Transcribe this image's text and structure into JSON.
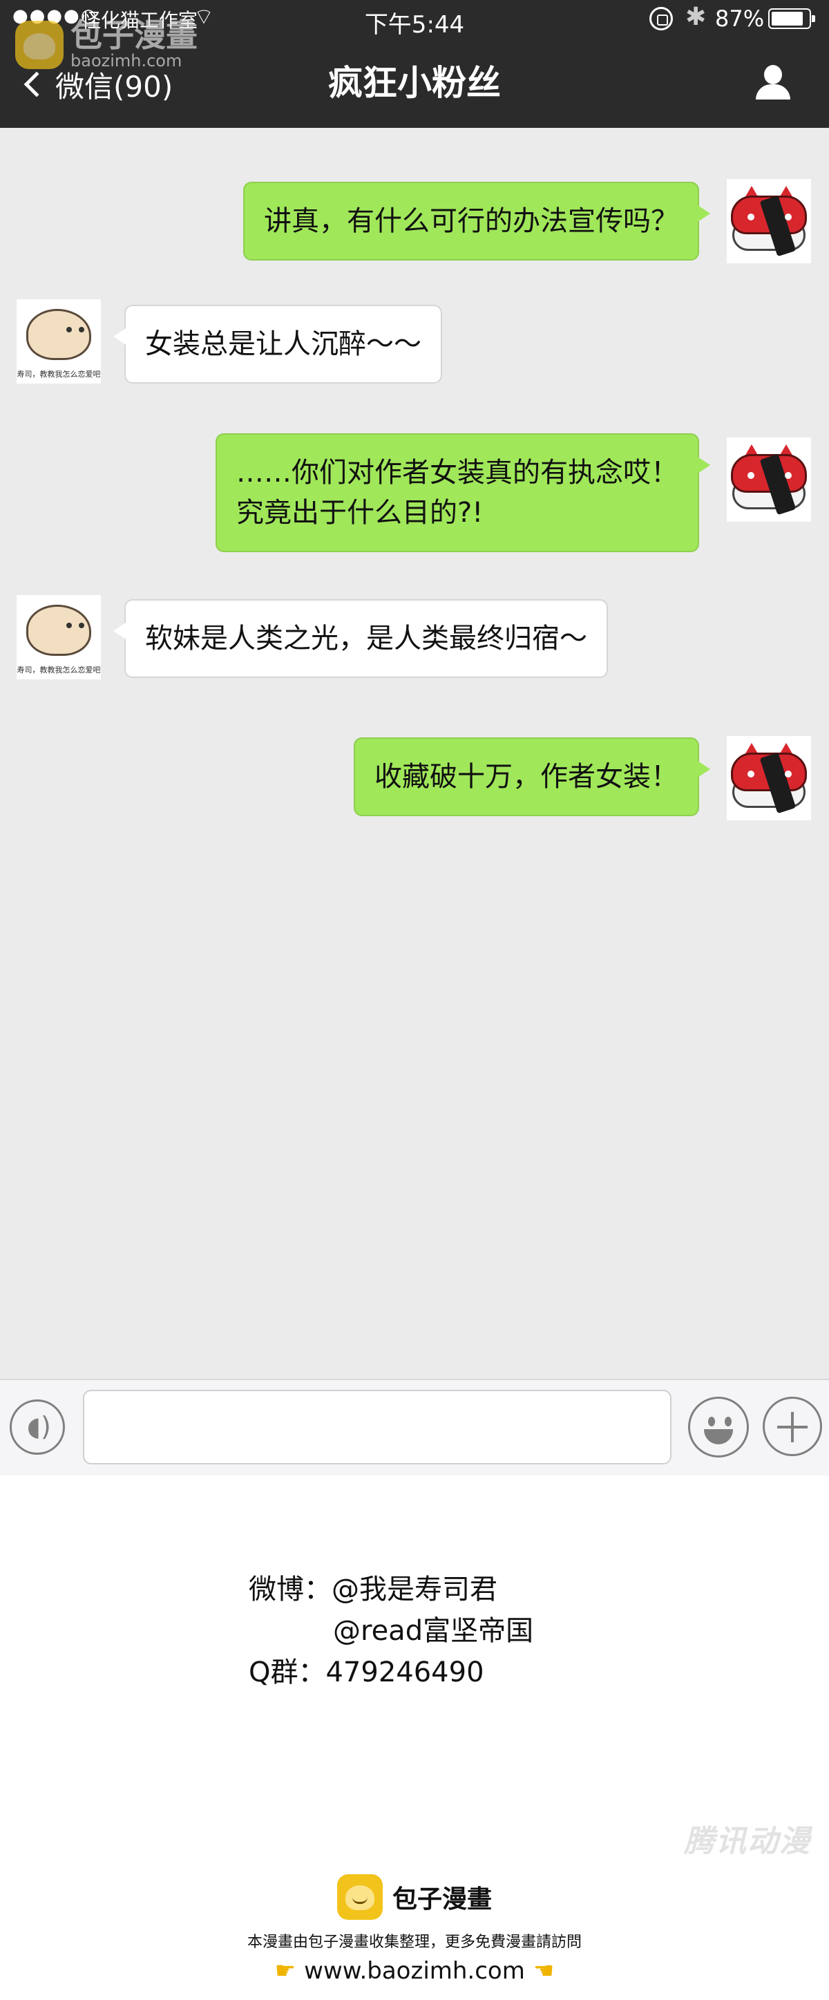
{
  "status_bar": {
    "signal": "●●●●○",
    "carrier": "怪化猫工作室",
    "time": "下午5:44",
    "battery_percent": "87%",
    "battery_level": 0.87
  },
  "nav": {
    "back_label": "微信(90)",
    "title": "疯狂小粉丝"
  },
  "watermark": {
    "brand": "包子漫畫",
    "url": "baozimh.com"
  },
  "messages": [
    {
      "from": "me",
      "text": "讲真，有什么可行的办法宣传吗？"
    },
    {
      "from": "them",
      "text": "女装总是让人沉醉～～"
    },
    {
      "from": "me",
      "lines": [
        "……你们对作者女装真的有执念哎！",
        "究竟出于什么目的?!"
      ]
    },
    {
      "from": "them",
      "text": "软妹是人类之光，是人类最终归宿～"
    },
    {
      "from": "me",
      "text": "收藏破十万，作者女装！"
    }
  ],
  "avatar_caption": "寿司，教教我怎么恋爱吧",
  "input_bar": {
    "text_value": ""
  },
  "credits": {
    "weibo_label": "微博：",
    "weibo_1": "@我是寿司君",
    "weibo_2": "@read富坚帝国",
    "qq_label": "Q群：",
    "qq_number": "479246490"
  },
  "tencent_watermark": "腾讯动漫",
  "footer": {
    "brand": "包子漫畫",
    "note": "本漫畫由包子漫畫收集整理，更多免費漫畫請訪問",
    "url": "www.baozimh.com"
  },
  "colors": {
    "nav_bg": "#2b2b2b",
    "chat_bg": "#ebebeb",
    "my_bubble": "#a0e75a",
    "their_bubble": "#ffffff"
  }
}
